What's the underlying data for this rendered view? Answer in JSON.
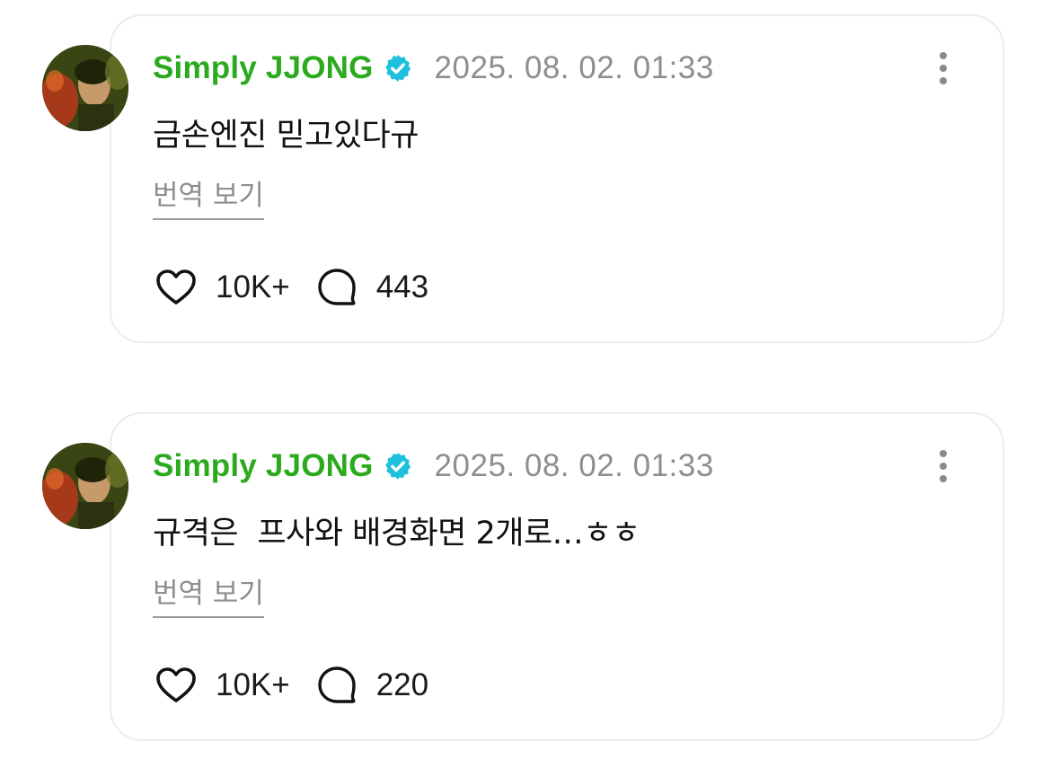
{
  "posts": [
    {
      "author": "Simply JJONG",
      "verified_icon": "verified-badge-icon",
      "timestamp": "2025. 08. 02. 01:33",
      "text": "금손엔진 믿고있다규",
      "translate_label": "번역 보기",
      "likes": "10K+",
      "comments": "443"
    },
    {
      "author": "Simply JJONG",
      "verified_icon": "verified-badge-icon",
      "timestamp": "2025. 08. 02. 01:33",
      "text": "규격은  프사와 배경화면 2개로…ㅎㅎ",
      "translate_label": "번역 보기",
      "likes": "10K+",
      "comments": "220"
    }
  ],
  "colors": {
    "username": "#2aaa1c",
    "verified": "#1ec0dd",
    "muted": "#8e8e8e",
    "card_border": "#ececec"
  }
}
